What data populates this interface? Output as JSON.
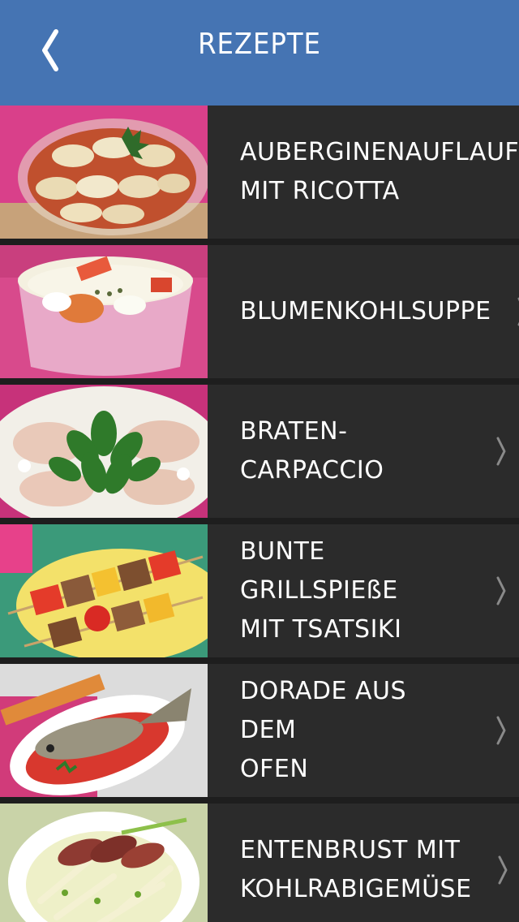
{
  "nav": {
    "title": "REZEPTE",
    "back_icon": "chevron-left-icon"
  },
  "recipes": [
    {
      "title": "AUBERGINENAUFLAUF\nMIT RICOTTA",
      "image": "eggplant-casserole"
    },
    {
      "title": "BLUMENKOHLSUPPE",
      "image": "cauliflower-soup"
    },
    {
      "title": "BRATEN-CARPACCIO",
      "image": "roast-carpaccio"
    },
    {
      "title": "BUNTE GRILLSPIEßE\nMIT TSATSIKI",
      "image": "grill-skewers"
    },
    {
      "title": "DORADE AUS DEM\nOFEN",
      "image": "baked-sea-bream"
    },
    {
      "title": "ENTENBRUST MIT\nKOHLRABIGEMÜSE",
      "image": "duck-breast-kohlrabi"
    }
  ],
  "colors": {
    "navbar": "#4574b3",
    "row_background": "#2b2b2b",
    "separator": "#1e1e1e",
    "text": "#ffffff",
    "chevron": "#8a8a8a"
  }
}
